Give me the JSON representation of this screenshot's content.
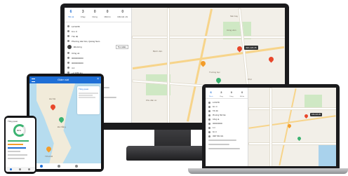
{
  "monitor": {
    "tabs": [
      {
        "num": "6",
        "label": "Tất cả"
      },
      {
        "num": "3",
        "label": "Chạy"
      },
      {
        "num": "0",
        "label": "Dừng"
      },
      {
        "num": "0",
        "label": "Mất tín"
      },
      {
        "num": "0",
        "label": "Mất kết nối"
      }
    ],
    "rows": [
      "14:50:55",
      "Km: 0",
      "Tốc độ",
      "Phường Hải Vân, Quảng Nam",
      "Đã dừng",
      "Cổng xả",
      "0000000000",
      "0000000000",
      "4.4",
      "+2.3456 km",
      "Km 0",
      "0987 654 321"
    ],
    "search_label": "Tìm kiếm",
    "map_labels": [
      "Sân bay",
      "Công viên",
      "Bệnh viện",
      "Trường học",
      "Khu dân cư",
      "Chợ"
    ],
    "vehicle_tag": "43A-123.45"
  },
  "tablet": {
    "title": "Giám sát",
    "panel_title": "Tổng quan",
    "map_labels": [
      "Hà Nội",
      "Đà Nẵng",
      "TP.HCM"
    ]
  },
  "phone": {
    "title": "Tổng quan",
    "gauge_value": "80%"
  },
  "laptop": {
    "tabs": [
      {
        "num": "6",
        "label": "Tất cả"
      },
      {
        "num": "3",
        "label": "Chạy"
      },
      {
        "num": "0",
        "label": "Dừng"
      },
      {
        "num": "0",
        "label": "Mất tín"
      }
    ],
    "rows": [
      "14:50:55",
      "Km: 0",
      "Tốc độ",
      "Phường Hải Vân",
      "Cổng xả",
      "0000000000",
      "4.4",
      "Km 0",
      "0987 654 321"
    ],
    "vehicle_tag": "43A-123.45"
  },
  "colors": {
    "accent": "#1f6fd6",
    "pin_red": "#e8472b",
    "pin_orange": "#f39c2a",
    "green": "#3cb371"
  }
}
